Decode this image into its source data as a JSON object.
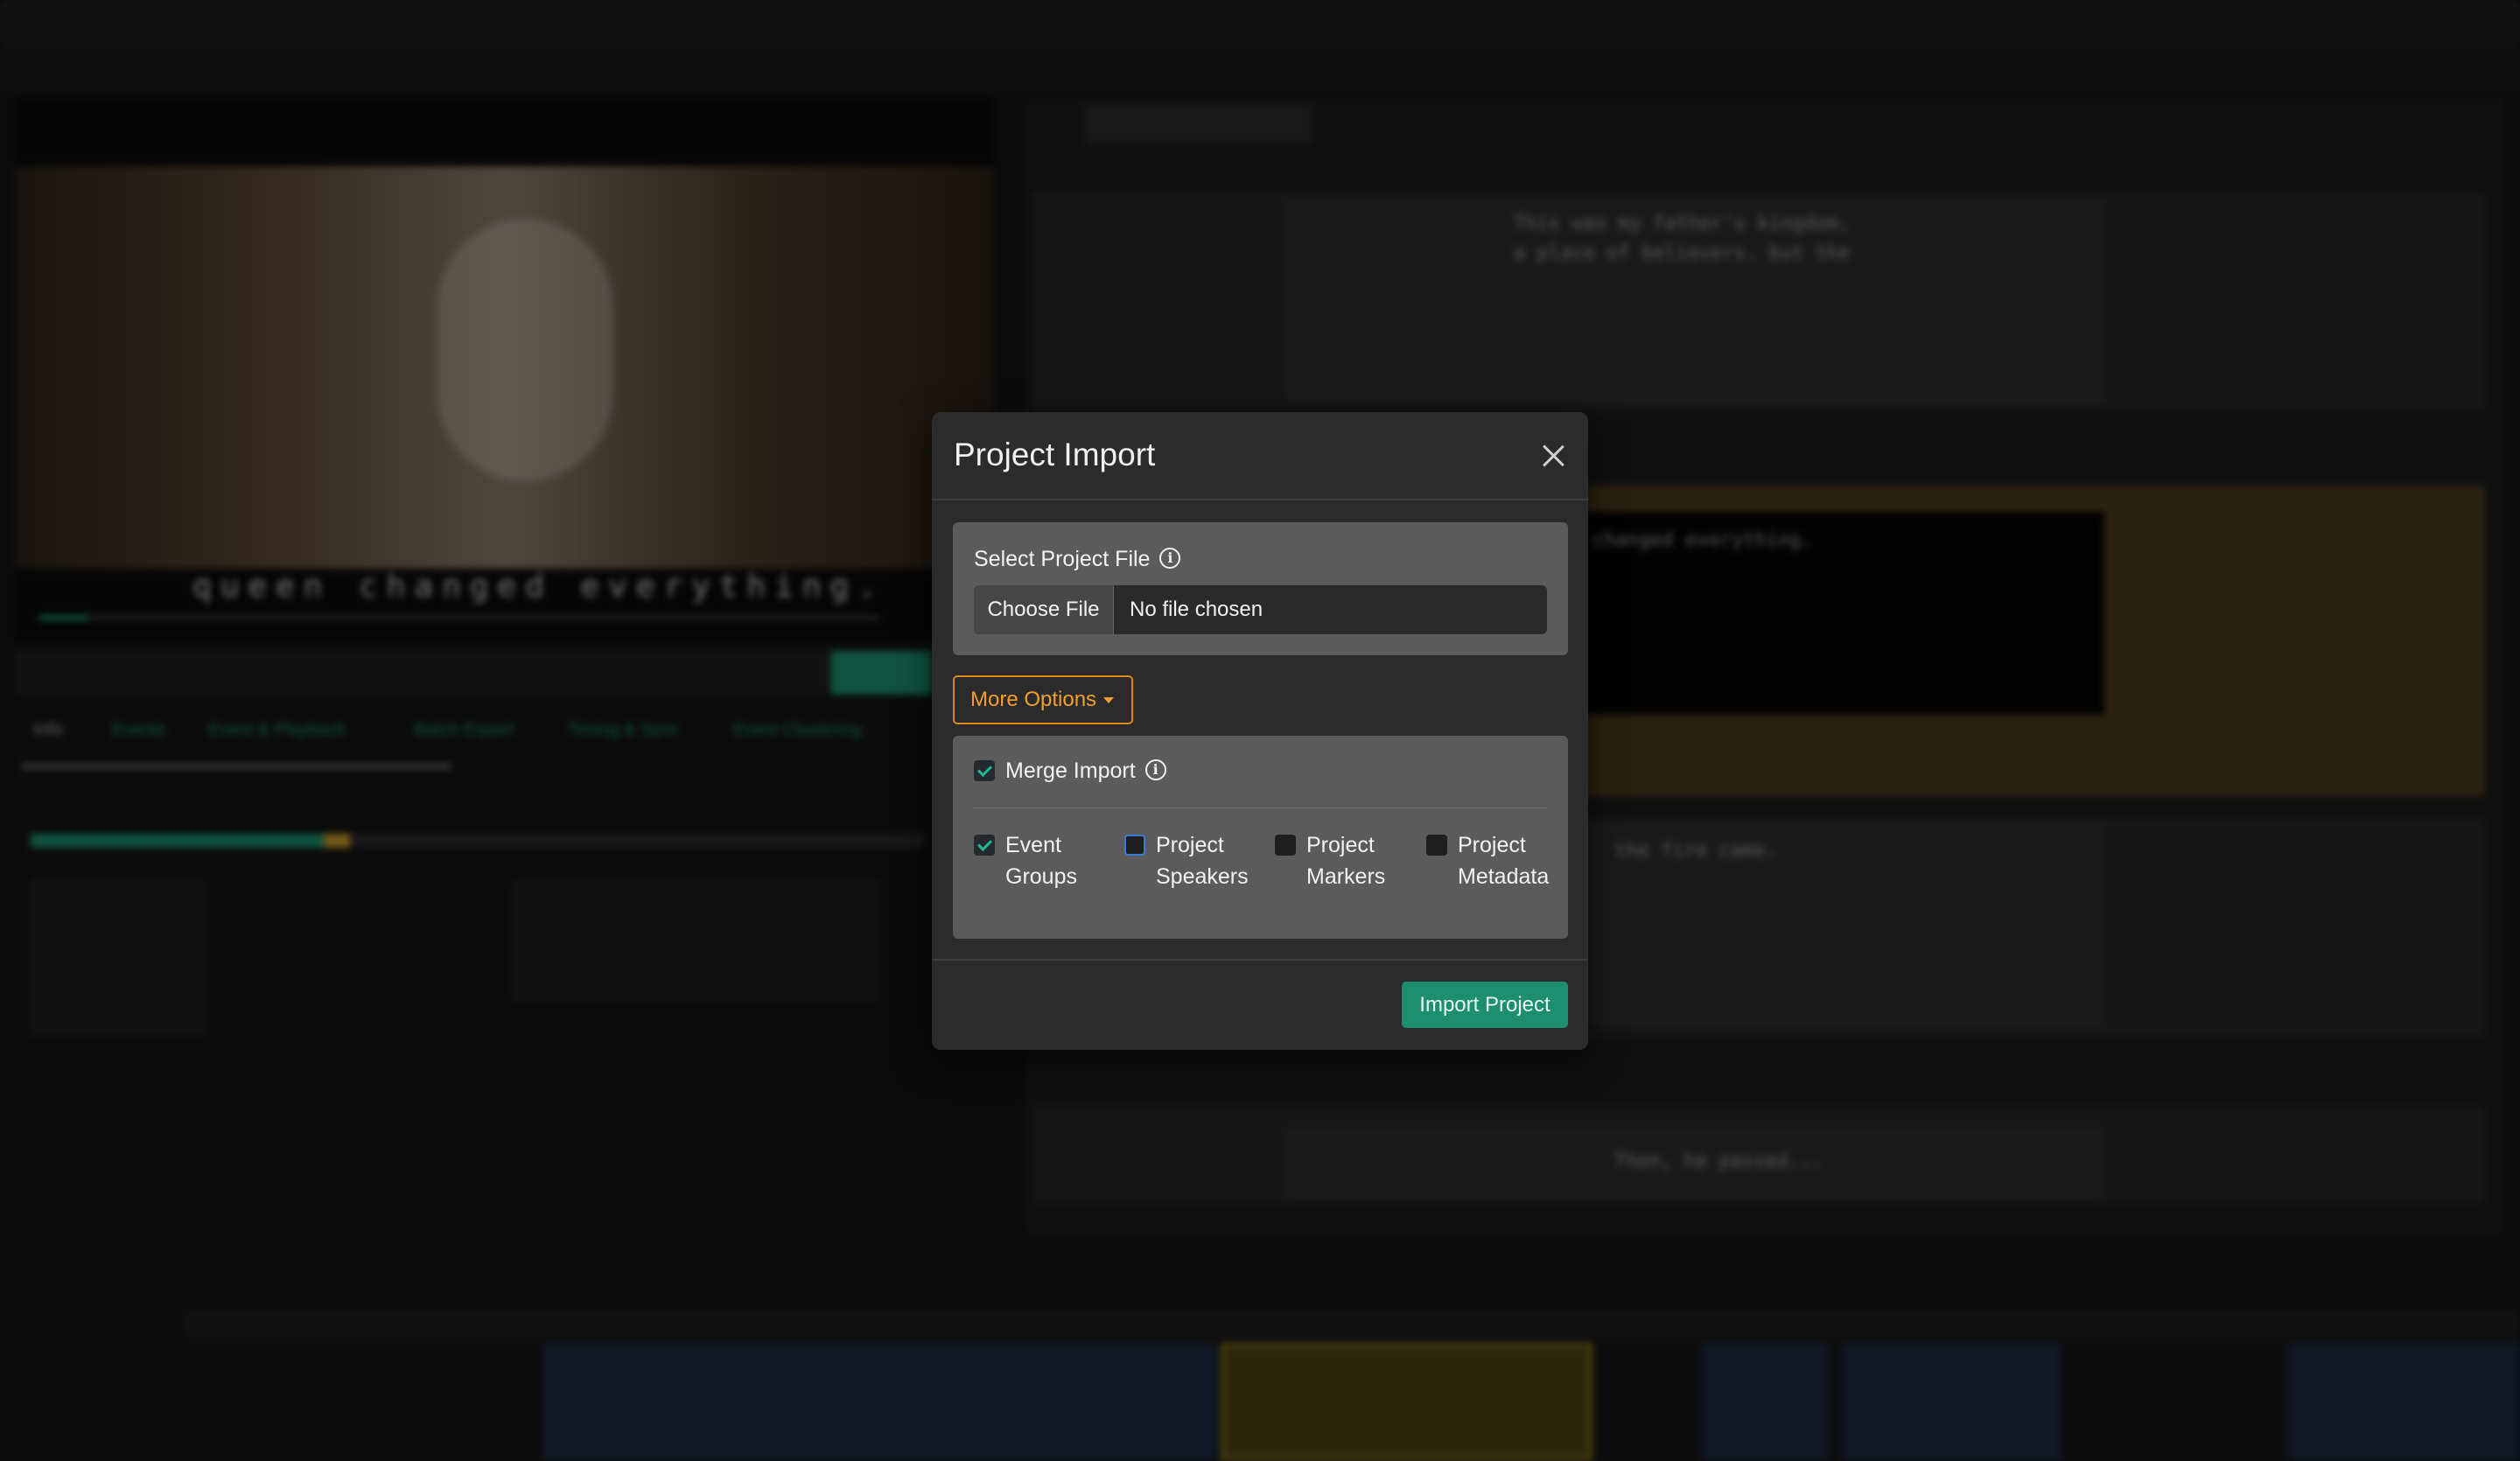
{
  "modal": {
    "title": "Project Import",
    "select_file_label": "Select Project File",
    "choose_file_label": "Choose File",
    "file_status": "No file chosen",
    "more_options_label": "More Options",
    "merge_import": {
      "label": "Merge Import",
      "checked": true
    },
    "options": [
      {
        "line1": "Event",
        "line2": "Groups",
        "checked": true
      },
      {
        "line1": "Project",
        "line2": "Speakers",
        "checked": false
      },
      {
        "line1": "Project",
        "line2": "Markers",
        "checked": false
      },
      {
        "line1": "Project",
        "line2": "Metadata",
        "checked": false
      }
    ],
    "import_button_label": "Import Project"
  },
  "background": {
    "subtitle_text": "queen changed everything.",
    "editor_lines": [
      "This was my father's kingdom,",
      "a place of believers. but the",
      "changed everything.",
      "the fire came.",
      "Then, he passed..."
    ],
    "tabs": [
      "Info",
      "Events",
      "Event & Playback",
      "Batch Export",
      "Timing & Sync",
      "Event Clustering"
    ],
    "colors": {
      "accent_green": "#1d8f6f",
      "accent_orange": "#e08a14",
      "focus_blue": "#3a7bd5"
    }
  }
}
